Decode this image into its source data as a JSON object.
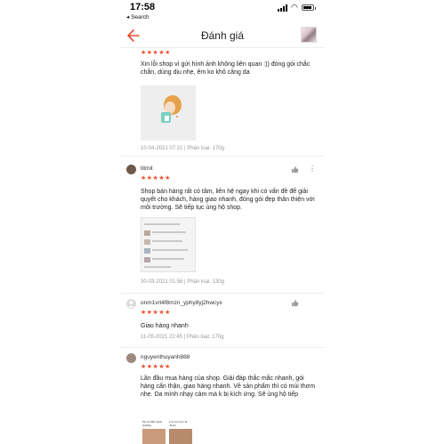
{
  "status_bar": {
    "time": "17:58",
    "back_app": "◂ Search",
    "battery_level": 0.85
  },
  "header": {
    "title": "Đánh giá",
    "back_icon": "back-arrow-icon",
    "thumb_icon": "product-thumbnail"
  },
  "accent_color": "#ee4d2d",
  "reviews": [
    {
      "username": "",
      "rating": 5,
      "stars": "★★★★★",
      "text": "Xin lỗi shop vì gửi hình ảnh không liên quan :)) đóng gói chắc chắn, dùng dịu nhẹ, êm ko khô căng da",
      "meta": "10-04-2021 07:21 | Phân loại: 170g"
    },
    {
      "username": "titmit",
      "rating": 5,
      "stars": "★★★★★",
      "text": "Shop bán hàng rất có tâm, liên hệ ngay khi có vấn đề để giải quyết cho khách, hàng giao nhanh, đóng gói đẹp thân thiện với môi trường. Sẽ tiếp tục ủng hộ shop.",
      "meta": "30-03-2021 01:58 | Phân loại: 130g"
    },
    {
      "username": "onm1vrl4f8mzn_yphy8yj2hwcyx",
      "rating": 5,
      "stars": "★★★★★",
      "text": "Giao hàng nhanh",
      "meta": "11-05-2021 22:45 | Phân loại: 170g"
    },
    {
      "username": "nguyenthuyanh888",
      "rating": 5,
      "stars": "★★★★★",
      "text": "Lần đầu mua hàng của shop. Giải đáp thắc mắc nhanh, gói hàng cẩn thận, giao hàng nhanh. Về sản phẩm thì có mùi thơm nhẹ. Da mình nhạy cảm mà k bị kích ứng. Sẽ ủng hộ tiếp",
      "meta": "",
      "photo_labels": [
        "Nụ bà Bắc bình thường",
        "Lúc nổi xào đi chuột"
      ]
    }
  ]
}
